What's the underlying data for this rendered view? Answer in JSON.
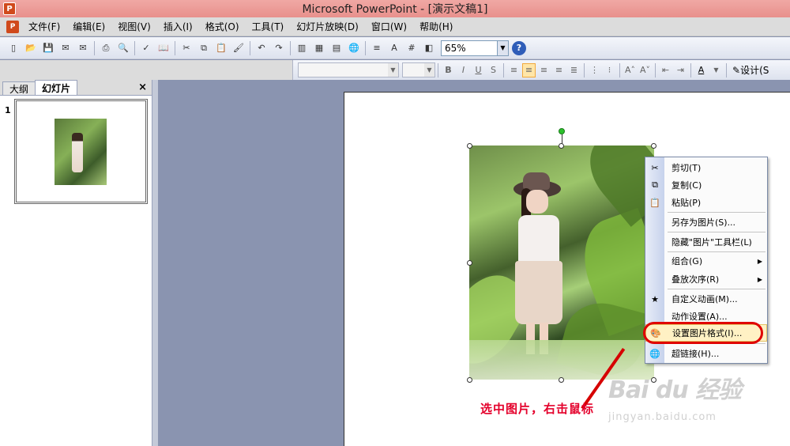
{
  "window": {
    "title": "Microsoft PowerPoint - [演示文稿1]"
  },
  "menu": {
    "items": [
      "文件(F)",
      "编辑(E)",
      "视图(V)",
      "插入(I)",
      "格式(O)",
      "工具(T)",
      "幻灯片放映(D)",
      "窗口(W)",
      "帮助(H)"
    ]
  },
  "toolbar": {
    "zoom": "65%",
    "design_label": "设计(S"
  },
  "left_pane": {
    "tabs": [
      "大纲",
      "幻灯片"
    ],
    "close": "×",
    "slide_number": "1"
  },
  "context_menu": {
    "items": [
      {
        "label": "剪切(T)",
        "icon": "scissors-icon"
      },
      {
        "label": "复制(C)",
        "icon": "copy-icon"
      },
      {
        "label": "粘贴(P)",
        "icon": "paste-icon"
      },
      {
        "label": "另存为图片(S)..."
      },
      {
        "label": "隐藏\"图片\"工具栏(L)"
      },
      {
        "label": "组合(G)",
        "submenu": true
      },
      {
        "label": "叠放次序(R)",
        "submenu": true
      },
      {
        "label": "自定义动画(M)...",
        "icon": "animation-icon"
      },
      {
        "label": "动作设置(A)..."
      },
      {
        "label": "设置图片格式(I)...",
        "icon": "format-picture-icon",
        "highlighted": true
      },
      {
        "label": "超链接(H)...",
        "icon": "hyperlink-icon"
      }
    ]
  },
  "annotation": "选中图片，右击鼠标",
  "watermark": {
    "main": "Bai du 经验",
    "sub": "jingyan.baidu.com"
  },
  "colors": {
    "title_bar": "#e8908c",
    "annotation": "#e4002b",
    "highlight_oval": "#e00000"
  }
}
